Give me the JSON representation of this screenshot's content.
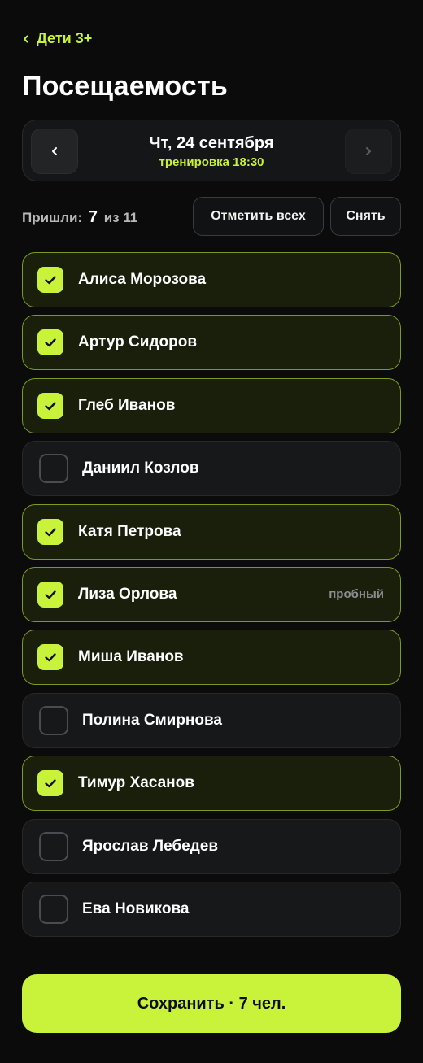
{
  "header": {
    "back_label": "Дети 3+",
    "title": "Посещаемость"
  },
  "datebar": {
    "date": "Чт, 24 сентября",
    "session": "тренировка 18:30"
  },
  "summary": {
    "label": "Пришли:",
    "present": "7",
    "of": "из 11",
    "mark_all": "Отметить всех",
    "clear": "Снять"
  },
  "students": [
    {
      "name": "Алиса Морозова",
      "checked": true,
      "tag": ""
    },
    {
      "name": "Артур Сидоров",
      "checked": true,
      "tag": ""
    },
    {
      "name": "Глеб Иванов",
      "checked": true,
      "tag": ""
    },
    {
      "name": "Даниил Козлов",
      "checked": false,
      "tag": ""
    },
    {
      "name": "Катя Петрова",
      "checked": true,
      "tag": ""
    },
    {
      "name": "Лиза Орлова",
      "checked": true,
      "tag": "пробный"
    },
    {
      "name": "Миша Иванов",
      "checked": true,
      "tag": ""
    },
    {
      "name": "Полина Смирнова",
      "checked": false,
      "tag": ""
    },
    {
      "name": "Тимур Хасанов",
      "checked": true,
      "tag": ""
    },
    {
      "name": "Ярослав Лебедев",
      "checked": false,
      "tag": ""
    },
    {
      "name": "Ева Новикова",
      "checked": false,
      "tag": ""
    }
  ],
  "save_label": "Сохранить · 7 чел.",
  "colors": {
    "accent": "#c9f23a",
    "background": "#0b0b0b"
  },
  "icons": {
    "back": "chevron-left-icon",
    "prev": "chevron-left-icon",
    "next": "chevron-right-icon",
    "check": "check-icon"
  }
}
